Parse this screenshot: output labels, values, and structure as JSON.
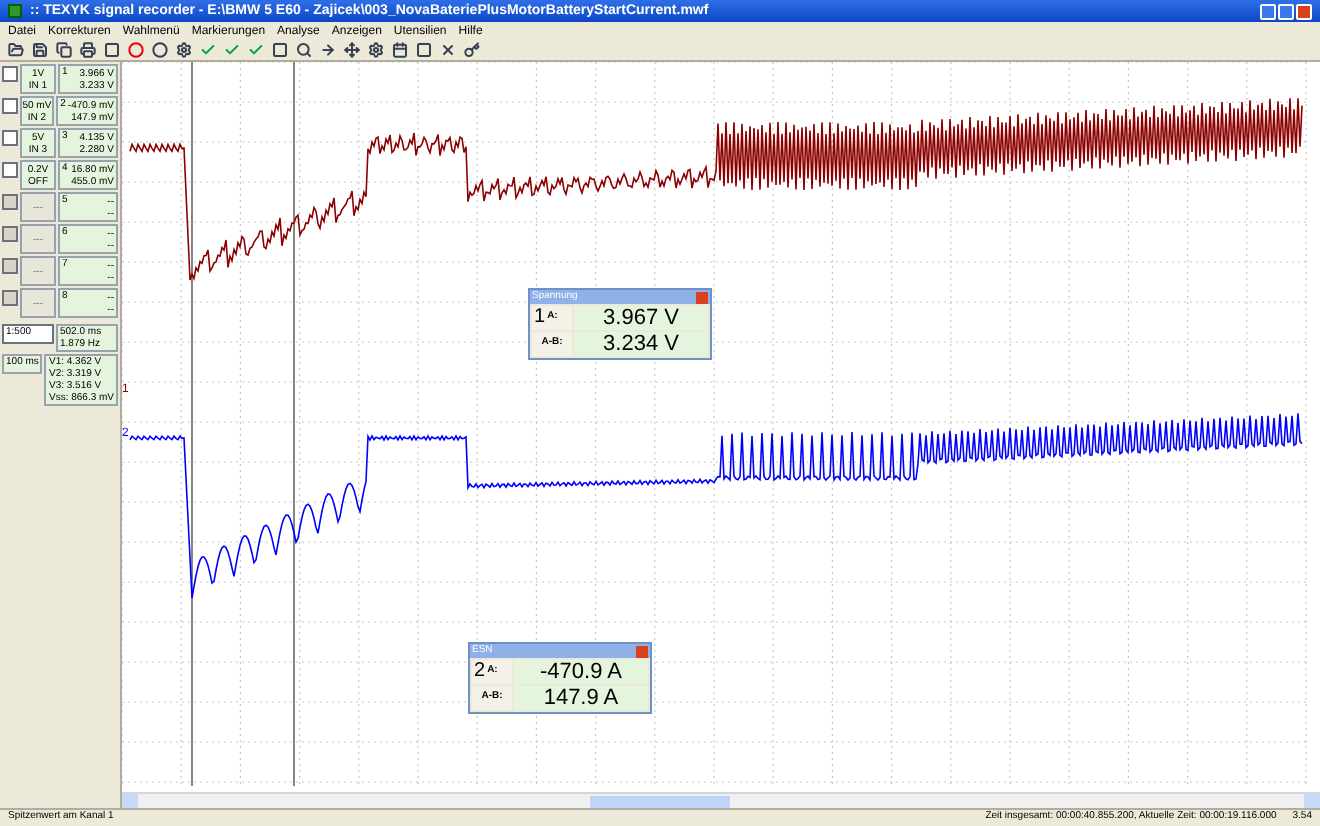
{
  "window": {
    "title": ":: TEXYK signal recorder - E:\\BMW 5 E60 - Zajicek\\003_NovaBateriePlusMotorBatteryStartCurrent.mwf"
  },
  "menu": [
    "Datei",
    "Korrekturen",
    "Wahlmenü",
    "Markierungen",
    "Analyse",
    "Anzeigen",
    "Utensilien",
    "Hilfe"
  ],
  "channels": [
    {
      "number": "1",
      "range": "1V",
      "input": "IN 1",
      "readings": [
        "3.966 V",
        "3.233 V"
      ],
      "active": true
    },
    {
      "number": "2",
      "range": "50 mV",
      "input": "IN 2",
      "readings": [
        "-470.9 mV",
        "147.9 mV"
      ],
      "active": true
    },
    {
      "number": "3",
      "range": "5V",
      "input": "IN 3",
      "readings": [
        "4.135 V",
        "2.280 V"
      ],
      "active": true
    },
    {
      "number": "4",
      "range": "0.2V",
      "input": "OFF",
      "readings": [
        "16.80 mV",
        "455.0 mV"
      ],
      "active": true
    },
    {
      "number": "5",
      "range": "---",
      "readings": [
        "--",
        "--"
      ],
      "active": false
    },
    {
      "number": "6",
      "range": "---",
      "readings": [
        "--",
        "--"
      ],
      "active": false
    },
    {
      "number": "7",
      "range": "---",
      "readings": [
        "--",
        "--"
      ],
      "active": false
    },
    {
      "number": "8",
      "range": "---",
      "readings": [
        "--",
        "--"
      ],
      "active": false
    }
  ],
  "timebase": {
    "zoom": "1:500",
    "period": "100 ms"
  },
  "cursor_info": [
    "502.0 ms",
    "1.879 Hz"
  ],
  "levels": [
    "V1: 4.362 V",
    "V2: 3.319 V",
    "V3: 3.516 V",
    "Vss: 866.3 mV"
  ],
  "trace_labels": [
    {
      "label": "1",
      "color": "#8b0000"
    },
    {
      "label": "2",
      "color": "#0000ff"
    }
  ],
  "dialogs": [
    {
      "title": "Spannung",
      "channel": "1",
      "a_label": "A:",
      "a_value": "3.967 V",
      "ab_label": "A-B:",
      "ab_value": "3.234 V"
    },
    {
      "title": "ESN",
      "channel": "2",
      "a_label": "A:",
      "a_value": "-470.9 A",
      "ab_label": "A-B:",
      "ab_value": "147.9 A"
    }
  ],
  "status_bar": {
    "left": "Spitzenwert am Kanal 1",
    "right": "Zeit insgesamt: 00:00:40.855.200, Aktuelle Zeit: 00:00:19.116.000",
    "value": "3.54"
  }
}
